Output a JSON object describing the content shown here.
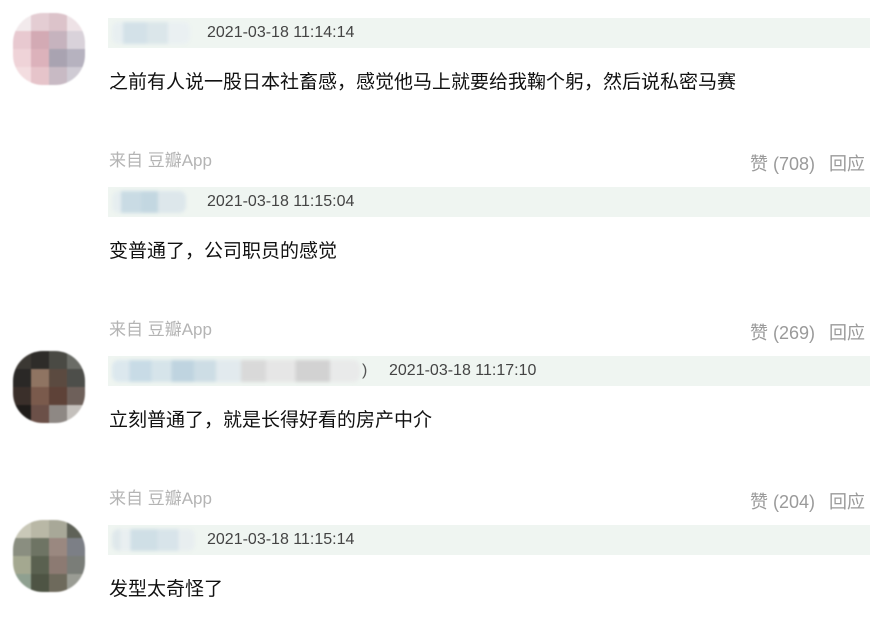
{
  "comments": [
    {
      "avatar_colors": [
        "#f2eaec",
        "#e4cdd3",
        "#dcc3ca",
        "#eee2e6",
        "#e8c9d0",
        "#d3aab4",
        "#c6b3be",
        "#d9d2da",
        "#efd3d8",
        "#dcb2bb",
        "#a9a3b1",
        "#b6b2bf",
        "#f3dde0",
        "#e6c4ca",
        "#c8bac4",
        "#cfcbd4"
      ],
      "time": "2021-03-18 11:14:14",
      "text": "之前有人说一股日本社畜感，感觉他马上就要给我鞠个躬，然后说私密马赛",
      "source": "来自 豆瓣App",
      "like_text": "赞 (708)",
      "reply_label": "回应"
    },
    {
      "time": "2021-03-18 11:15:04",
      "text": "变普通了，公司职员的感觉",
      "source": "来自 豆瓣App",
      "like_text": "赞 (269)",
      "reply_label": "回应"
    },
    {
      "avatar_colors": [
        "#3b3833",
        "#2e2c29",
        "#4a4a44",
        "#6a6c66",
        "#2a2826",
        "#8f7462",
        "#5b4a40",
        "#4d4e4a",
        "#3a2f2a",
        "#7a5a4c",
        "#5e4238",
        "#6e605a",
        "#1f1c1a",
        "#6b5048",
        "#8e8884",
        "#c4c0bc"
      ],
      "username_suffix": ")",
      "time": "2021-03-18 11:17:10",
      "text": "立刻普通了，就是长得好看的房产中介",
      "source": "来自 豆瓣App",
      "like_text": "赞 (204)",
      "reply_label": "回应"
    },
    {
      "avatar_colors": [
        "#c9c8b8",
        "#b9b8a6",
        "#a8a898",
        "#5f6258",
        "#8a8e80",
        "#6e7464",
        "#9a8880",
        "#7c7f86",
        "#a4a890",
        "#5a6150",
        "#8c7a72",
        "#7a7d78",
        "#8fa090",
        "#4e5444",
        "#6e6a5c",
        "#9a9c94"
      ],
      "time": "2021-03-18 11:15:14",
      "text": "发型太奇怪了"
    }
  ]
}
